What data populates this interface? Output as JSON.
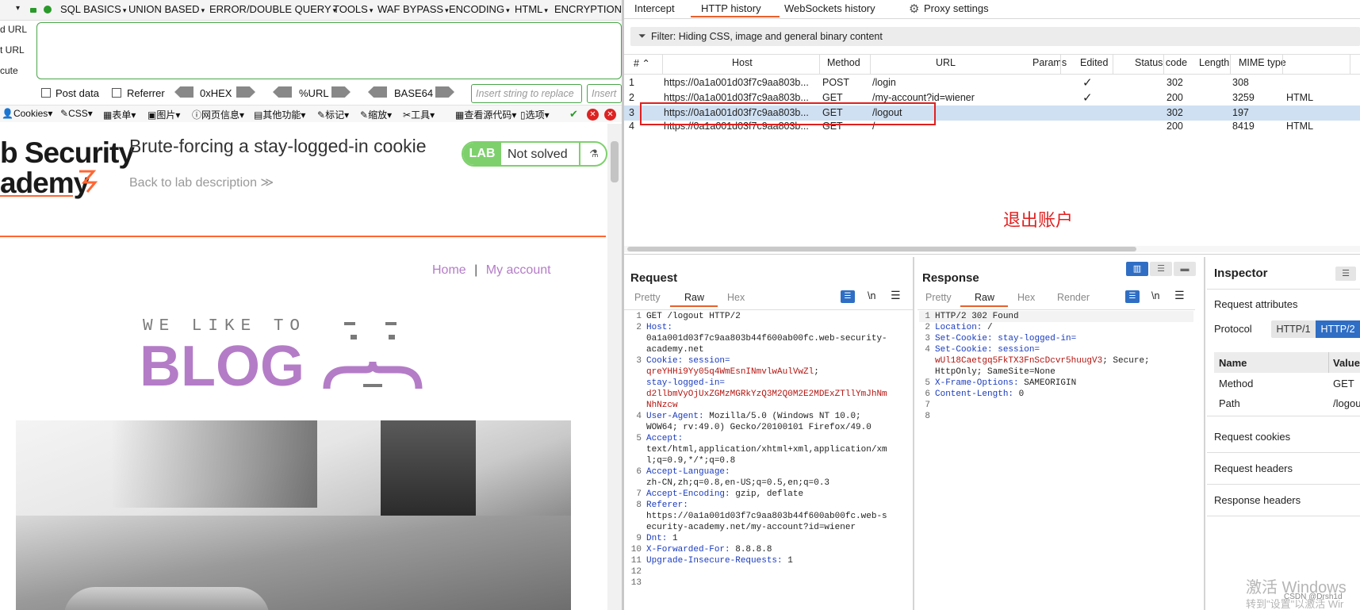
{
  "browser": {
    "menu_labels": [
      "SQL BASICS",
      "UNION BASED",
      "ERROR/DOUBLE QUERY",
      "TOOLS",
      "WAF BYPASS",
      "ENCODING",
      "HTML",
      "ENCRYPTION"
    ],
    "side_labels": [
      "d URL",
      "t URL",
      "cute"
    ],
    "post_data_label": "Post data",
    "referrer_label": "Referrer",
    "hex_label": "0xHEX",
    "url_label": "%URL",
    "base64_label": "BASE64",
    "insert_placeholder": "Insert string to replace",
    "insert_placeholder2": "Insert",
    "toolbar2": [
      "Cookies",
      "CSS",
      "表单",
      "图片",
      "网页信息",
      "其他功能",
      "标记",
      "缩放",
      "工具",
      "查看源代码",
      "选项"
    ]
  },
  "lab": {
    "logo_line1": "b Security",
    "logo_line2": "ademy",
    "title": "Brute-forcing a stay-logged-in cookie",
    "back_link": "Back to lab description",
    "badge_lab": "LAB",
    "badge_status": "Not solved",
    "nav_home": "Home",
    "nav_sep": "|",
    "nav_account": "My account",
    "blog_small": "WE LIKE TO",
    "blog_big": "BLOG"
  },
  "burp": {
    "tabs": [
      "Intercept",
      "HTTP history",
      "WebSockets history",
      "Proxy settings"
    ],
    "active_tab": "HTTP history",
    "filter_text": "Filter: Hiding CSS, image and general binary content",
    "columns": [
      "#",
      "Host",
      "Method",
      "URL",
      "Params",
      "Edited",
      "Status code",
      "Length",
      "MIME type"
    ],
    "rows": [
      {
        "num": "1",
        "host": "https://0a1a001d03f7c9aa803b...",
        "method": "POST",
        "url": "/login",
        "params": "✓",
        "status": "302",
        "length": "308",
        "mime": ""
      },
      {
        "num": "2",
        "host": "https://0a1a001d03f7c9aa803b...",
        "method": "GET",
        "url": "/my-account?id=wiener",
        "params": "✓",
        "status": "200",
        "length": "3259",
        "mime": "HTML"
      },
      {
        "num": "3",
        "host": "https://0a1a001d03f7c9aa803b...",
        "method": "GET",
        "url": "/logout",
        "params": "",
        "status": "302",
        "length": "197",
        "mime": ""
      },
      {
        "num": "4",
        "host": "https://0a1a001d03f7c9aa803b...",
        "method": "GET",
        "url": "/",
        "params": "",
        "status": "200",
        "length": "8419",
        "mime": "HTML"
      }
    ],
    "annotation": "退出账户",
    "request": {
      "title": "Request",
      "tabs": [
        "Pretty",
        "Raw",
        "Hex"
      ],
      "active": "Raw",
      "newline_label": "\\n"
    },
    "response": {
      "title": "Response",
      "tabs": [
        "Pretty",
        "Raw",
        "Hex",
        "Render"
      ],
      "active": "Raw",
      "newline_label": "\\n"
    },
    "inspector": {
      "title": "Inspector",
      "req_attrs": "Request attributes",
      "protocol_label": "Protocol",
      "http1": "HTTP/1",
      "http2": "HTTP/2",
      "name_col": "Name",
      "value_col": "Value",
      "rows": [
        {
          "name": "Method",
          "value": "GET"
        },
        {
          "name": "Path",
          "value": "/logou"
        }
      ],
      "req_cookies": "Request cookies",
      "req_headers": "Request headers",
      "resp_headers": "Response headers"
    },
    "watermark1": "激活 Windows",
    "watermark2": "转到\"设置\"以激活 Wir",
    "csdn": "CSDN @Drsh1d"
  }
}
